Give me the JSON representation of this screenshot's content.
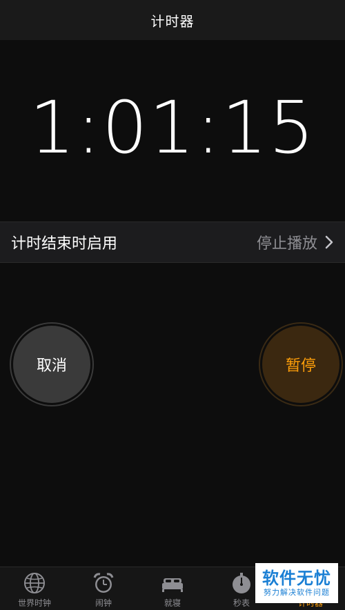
{
  "nav": {
    "title": "计时器"
  },
  "timer": {
    "display": "1:01:15"
  },
  "when_timer_ends": {
    "label": "计时结束时启用",
    "value": "停止播放"
  },
  "buttons": {
    "cancel_label": "取消",
    "pause_label": "暂停"
  },
  "tab_bar": {
    "items": [
      {
        "label": "世界时钟",
        "icon": "globe-icon",
        "active": false
      },
      {
        "label": "闹钟",
        "icon": "alarm-clock-icon",
        "active": false
      },
      {
        "label": "就寝",
        "icon": "bed-icon",
        "active": false
      },
      {
        "label": "秒表",
        "icon": "stopwatch-icon",
        "active": false
      },
      {
        "label": "计时器",
        "icon": "timer-icon",
        "active": true
      }
    ]
  },
  "watermark": {
    "title": "软件无忧",
    "subtitle": "努力解决软件问题"
  },
  "colors": {
    "accent": "#ff9f0a",
    "background": "#0d0d0d",
    "secondary_text": "#8e8e93"
  }
}
